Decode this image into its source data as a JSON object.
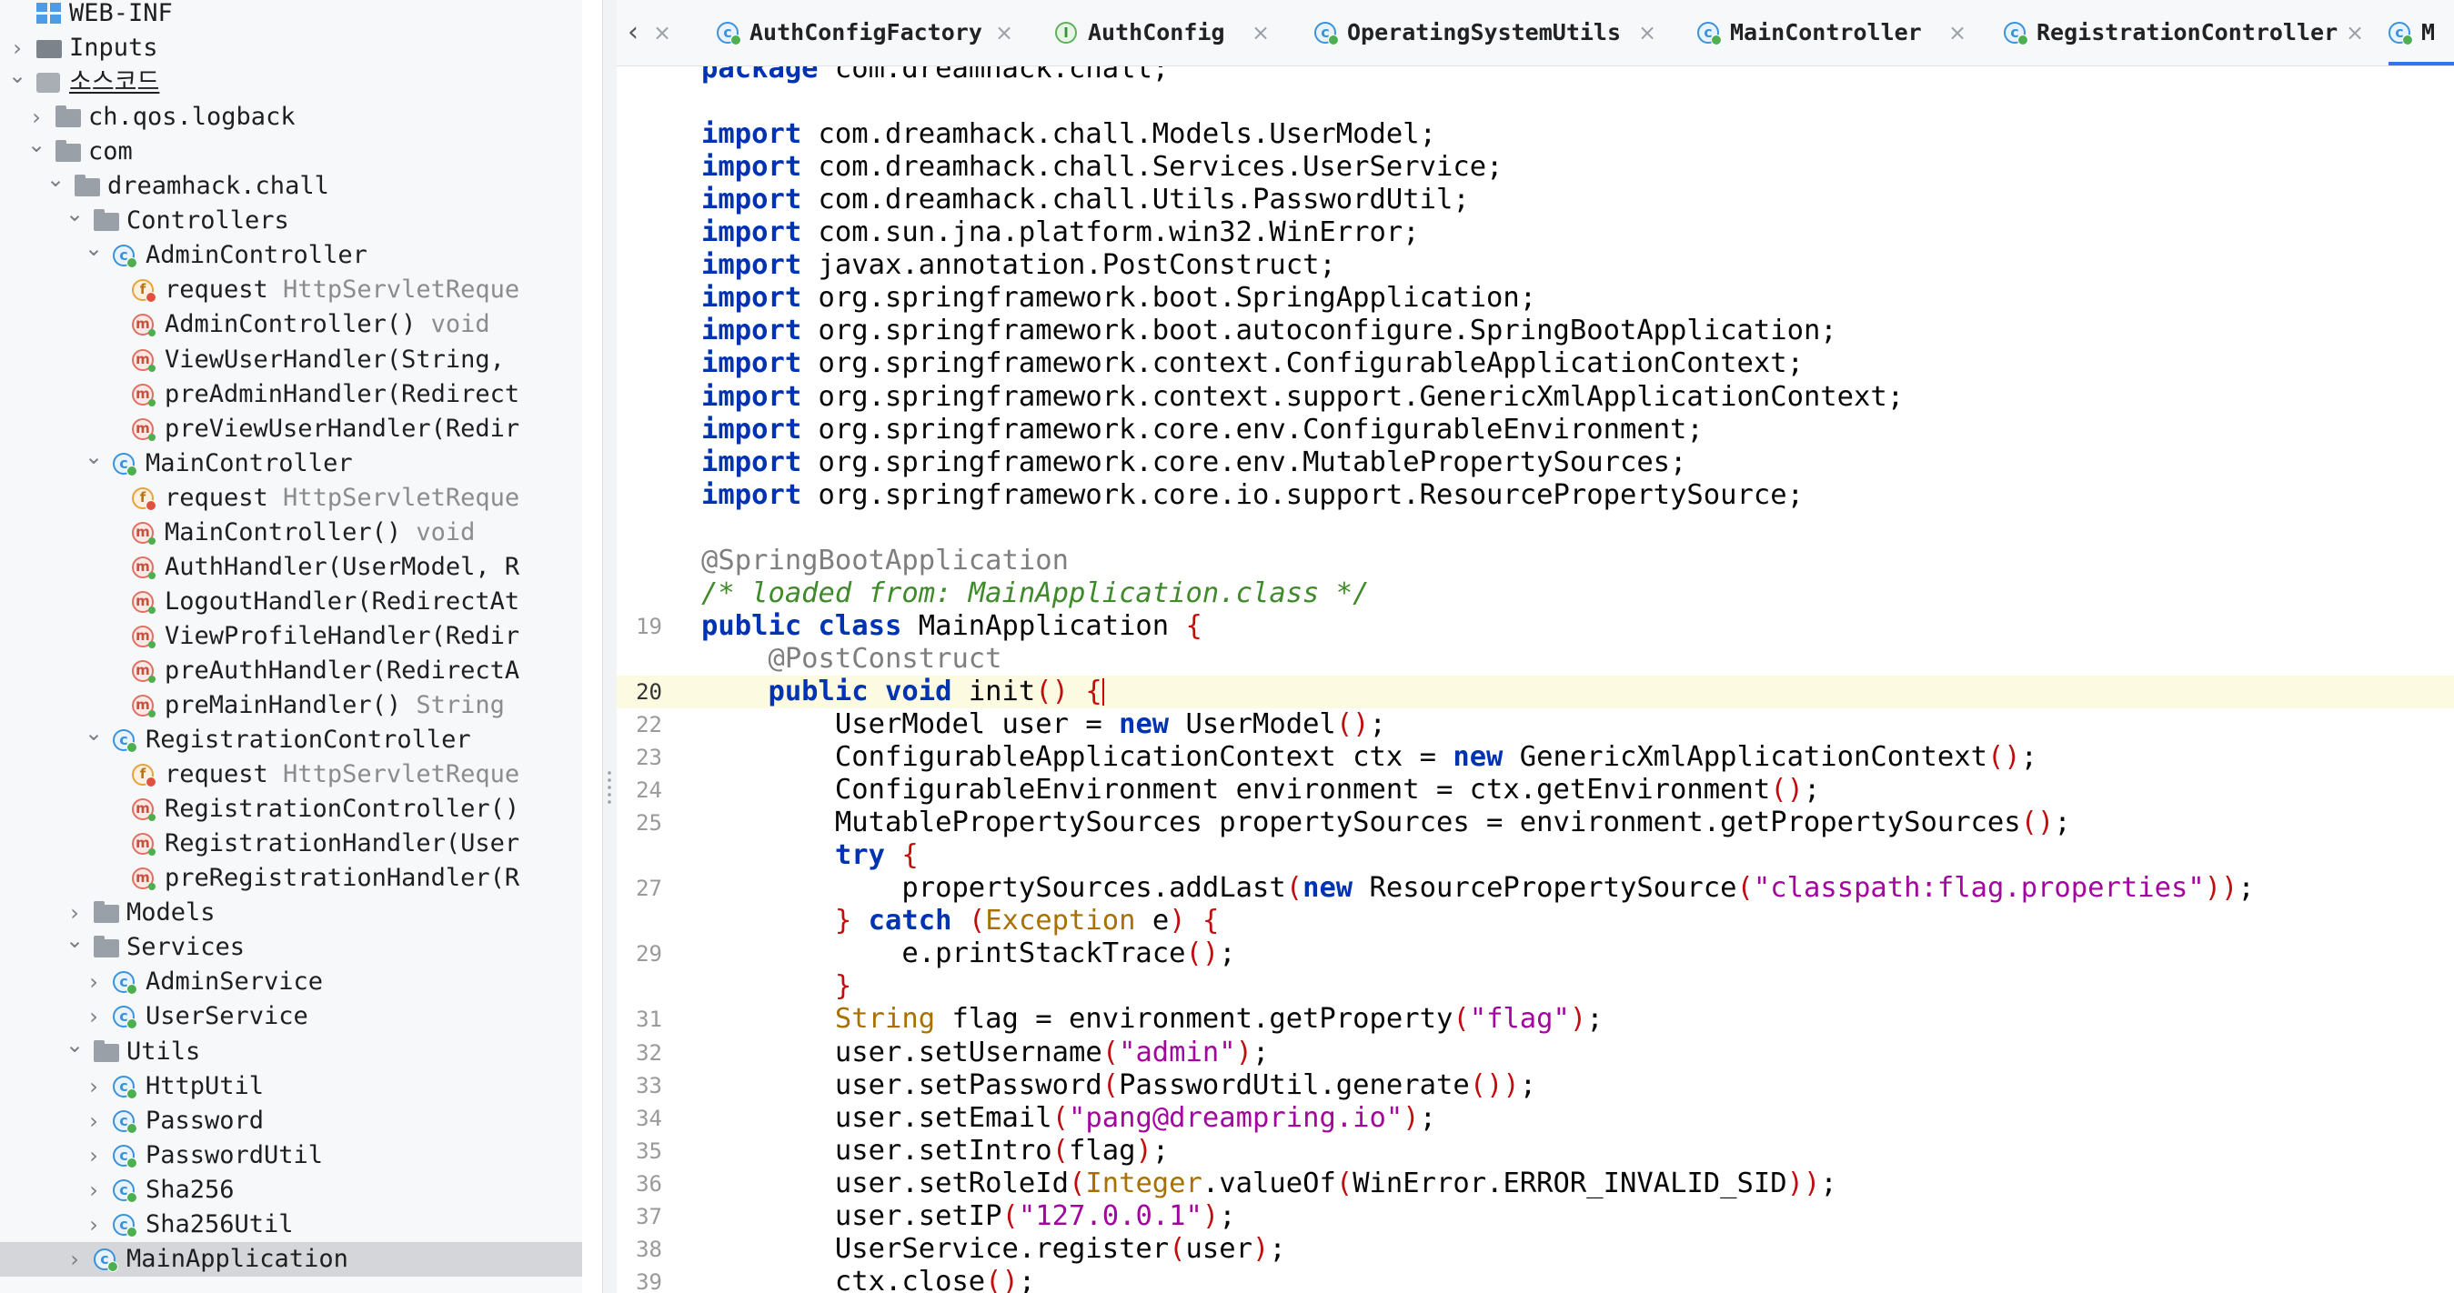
{
  "tree": [
    {
      "label": "WEB-INF",
      "icon": "web-inf-icon"
    },
    {
      "label": "Inputs",
      "icon": "inputs-folder-icon"
    },
    {
      "label": "소스코드",
      "icon": "source-root-icon"
    },
    {
      "label": "ch.qos.logback",
      "icon": "package-icon"
    },
    {
      "label": "com",
      "icon": "package-icon"
    },
    {
      "label": "dreamhack.chall",
      "icon": "package-icon"
    },
    {
      "label": "Controllers",
      "icon": "package-icon"
    },
    {
      "label": "AdminController",
      "icon": "class-icon"
    },
    {
      "label": "request",
      "type": "HttpServletReque",
      "icon": "field-icon"
    },
    {
      "label": "AdminController()",
      "type": "void",
      "icon": "method-icon"
    },
    {
      "label": "ViewUserHandler(String,",
      "icon": "method-icon"
    },
    {
      "label": "preAdminHandler(Redirect",
      "icon": "method-icon"
    },
    {
      "label": "preViewUserHandler(Redir",
      "icon": "method-icon"
    },
    {
      "label": "MainController",
      "icon": "class-icon"
    },
    {
      "label": "request",
      "type": "HttpServletReque",
      "icon": "field-icon"
    },
    {
      "label": "MainController()",
      "type": "void",
      "icon": "method-icon"
    },
    {
      "label": "AuthHandler(UserModel, R",
      "icon": "method-icon"
    },
    {
      "label": "LogoutHandler(RedirectAt",
      "icon": "method-icon"
    },
    {
      "label": "ViewProfileHandler(Redir",
      "icon": "method-icon"
    },
    {
      "label": "preAuthHandler(RedirectA",
      "icon": "method-icon"
    },
    {
      "label": "preMainHandler()",
      "type": "String",
      "icon": "method-icon"
    },
    {
      "label": "RegistrationController",
      "icon": "class-icon"
    },
    {
      "label": "request",
      "type": "HttpServletReque",
      "icon": "field-icon"
    },
    {
      "label": "RegistrationController()",
      "icon": "method-icon"
    },
    {
      "label": "RegistrationHandler(User",
      "icon": "method-icon"
    },
    {
      "label": "preRegistrationHandler(R",
      "icon": "method-icon"
    },
    {
      "label": "Models",
      "icon": "package-icon"
    },
    {
      "label": "Services",
      "icon": "package-icon"
    },
    {
      "label": "AdminService",
      "icon": "class-icon"
    },
    {
      "label": "UserService",
      "icon": "class-icon"
    },
    {
      "label": "Utils",
      "icon": "package-icon"
    },
    {
      "label": "HttpUtil",
      "icon": "class-icon"
    },
    {
      "label": "Password",
      "icon": "class-icon"
    },
    {
      "label": "PasswordUtil",
      "icon": "class-icon"
    },
    {
      "label": "Sha256",
      "icon": "class-icon"
    },
    {
      "label": "Sha256Util",
      "icon": "class-icon"
    },
    {
      "label": "MainApplication",
      "icon": "class-icon"
    }
  ],
  "tabs": [
    {
      "label": "AuthConfigFactory",
      "icon": "class-icon"
    },
    {
      "label": "AuthConfig",
      "icon": "interface-icon"
    },
    {
      "label": "OperatingSystemUtils",
      "icon": "class-icon"
    },
    {
      "label": "MainController",
      "icon": "class-icon"
    },
    {
      "label": "RegistrationController",
      "icon": "class-icon"
    },
    {
      "label": "M",
      "icon": "class-icon"
    }
  ],
  "tab_close_glyph": "×",
  "code": {
    "current_line": "20",
    "lines": [
      {
        "n": "",
        "t": [
          [
            "kw",
            "package"
          ],
          [
            "",
            "com.dreamhack.chall;"
          ]
        ]
      },
      {
        "n": "",
        "t": []
      },
      {
        "n": "",
        "t": [
          [
            "kw",
            "import"
          ],
          [
            "",
            " com.dreamhack.chall.Models.UserModel;"
          ]
        ]
      },
      {
        "n": "",
        "t": [
          [
            "kw",
            "import"
          ],
          [
            "",
            " com.dreamhack.chall.Services.UserService;"
          ]
        ]
      },
      {
        "n": "",
        "t": [
          [
            "kw",
            "import"
          ],
          [
            "",
            " com.dreamhack.chall.Utils.PasswordUtil;"
          ]
        ]
      },
      {
        "n": "",
        "t": [
          [
            "kw",
            "import"
          ],
          [
            "",
            " com.sun.jna.platform.win32.WinError;"
          ]
        ]
      },
      {
        "n": "",
        "t": [
          [
            "kw",
            "import"
          ],
          [
            "",
            " javax.annotation.PostConstruct;"
          ]
        ]
      },
      {
        "n": "",
        "t": [
          [
            "kw",
            "import"
          ],
          [
            "",
            " org.springframework.boot.SpringApplication;"
          ]
        ]
      },
      {
        "n": "",
        "t": [
          [
            "kw",
            "import"
          ],
          [
            "",
            " org.springframework.boot.autoconfigure.SpringBootApplication;"
          ]
        ]
      },
      {
        "n": "",
        "t": [
          [
            "kw",
            "import"
          ],
          [
            "",
            " org.springframework.context.ConfigurableApplicationContext;"
          ]
        ]
      },
      {
        "n": "",
        "t": [
          [
            "kw",
            "import"
          ],
          [
            "",
            " org.springframework.context.support.GenericXmlApplicationContext;"
          ]
        ]
      },
      {
        "n": "",
        "t": [
          [
            "kw",
            "import"
          ],
          [
            "",
            " org.springframework.core.env.ConfigurableEnvironment;"
          ]
        ]
      },
      {
        "n": "",
        "t": [
          [
            "kw",
            "import"
          ],
          [
            "",
            " org.springframework.core.env.MutablePropertySources;"
          ]
        ]
      },
      {
        "n": "",
        "t": [
          [
            "kw",
            "import"
          ],
          [
            "",
            " org.springframework.core.io.support.ResourcePropertySource;"
          ]
        ]
      },
      {
        "n": "",
        "t": []
      },
      {
        "n": "",
        "t": [
          [
            "ann",
            "@SpringBootApplication"
          ]
        ]
      },
      {
        "n": "",
        "t": [
          [
            "cm",
            "/* loaded from: MainApplication.class */"
          ]
        ]
      },
      {
        "n": "19",
        "t": [
          [
            "kw",
            "public class"
          ],
          [
            "",
            " MainApplication "
          ],
          [
            "par",
            "{"
          ]
        ]
      },
      {
        "n": "",
        "t": [
          [
            "ann",
            "    @PostConstruct"
          ]
        ]
      },
      {
        "n": "20",
        "t": [
          [
            "kw",
            "    public void"
          ],
          [
            "",
            " init"
          ],
          [
            "par",
            "()"
          ],
          [
            "",
            " "
          ],
          [
            "par",
            "{"
          ]
        ]
      },
      {
        "n": "22",
        "t": [
          [
            "",
            "        UserModel user = "
          ],
          [
            "kw",
            "new"
          ],
          [
            "",
            " UserModel"
          ],
          [
            "par",
            "()"
          ],
          [
            "",
            ";"
          ]
        ]
      },
      {
        "n": "23",
        "t": [
          [
            "",
            "        ConfigurableApplicationContext ctx = "
          ],
          [
            "kw",
            "new"
          ],
          [
            "",
            " GenericXmlApplicationContext"
          ],
          [
            "par",
            "()"
          ],
          [
            "",
            ";"
          ]
        ]
      },
      {
        "n": "24",
        "t": [
          [
            "",
            "        ConfigurableEnvironment environment = ctx.getEnvironment"
          ],
          [
            "par",
            "()"
          ],
          [
            "",
            ";"
          ]
        ]
      },
      {
        "n": "25",
        "t": [
          [
            "",
            "        MutablePropertySources propertySources = environment.getPropertySources"
          ],
          [
            "par",
            "()"
          ],
          [
            "",
            ";"
          ]
        ]
      },
      {
        "n": "",
        "t": [
          [
            "kw",
            "        try"
          ],
          [
            "",
            " "
          ],
          [
            "par",
            "{"
          ]
        ]
      },
      {
        "n": "27",
        "t": [
          [
            "",
            "            propertySources.addLast"
          ],
          [
            "par",
            "("
          ],
          [
            "kw",
            "new"
          ],
          [
            "",
            " ResourcePropertySource"
          ],
          [
            "par",
            "("
          ],
          [
            "str",
            "\"classpath:flag.properties\""
          ],
          [
            "par",
            "))"
          ],
          [
            "",
            ";"
          ]
        ]
      },
      {
        "n": "",
        "t": [
          [
            "par",
            "        }"
          ],
          [
            "",
            " "
          ],
          [
            "kw",
            "catch"
          ],
          [
            "",
            " "
          ],
          [
            "par",
            "("
          ],
          [
            "cls",
            "Exception"
          ],
          [
            "",
            " e"
          ],
          [
            "par",
            ")"
          ],
          [
            "",
            " "
          ],
          [
            "par",
            "{"
          ]
        ]
      },
      {
        "n": "29",
        "t": [
          [
            "",
            "            e.printStackTrace"
          ],
          [
            "par",
            "()"
          ],
          [
            "",
            ";"
          ]
        ]
      },
      {
        "n": "",
        "t": [
          [
            "par",
            "        }"
          ]
        ]
      },
      {
        "n": "31",
        "t": [
          [
            "cls",
            "        String"
          ],
          [
            "",
            " flag = environment.getProperty"
          ],
          [
            "par",
            "("
          ],
          [
            "str",
            "\"flag\""
          ],
          [
            "par",
            ")"
          ],
          [
            "",
            ";"
          ]
        ]
      },
      {
        "n": "32",
        "t": [
          [
            "",
            "        user.setUsername"
          ],
          [
            "par",
            "("
          ],
          [
            "str",
            "\"admin\""
          ],
          [
            "par",
            ")"
          ],
          [
            "",
            ";"
          ]
        ]
      },
      {
        "n": "33",
        "t": [
          [
            "",
            "        user.setPassword"
          ],
          [
            "par",
            "("
          ],
          [
            "",
            "PasswordUtil.generate"
          ],
          [
            "par",
            "())"
          ],
          [
            "",
            ";"
          ]
        ]
      },
      {
        "n": "34",
        "t": [
          [
            "",
            "        user.setEmail"
          ],
          [
            "par",
            "("
          ],
          [
            "str",
            "\"pang@dreampring.io\""
          ],
          [
            "par",
            ")"
          ],
          [
            "",
            ";"
          ]
        ]
      },
      {
        "n": "35",
        "t": [
          [
            "",
            "        user.setIntro"
          ],
          [
            "par",
            "("
          ],
          [
            "",
            "flag"
          ],
          [
            "par",
            ")"
          ],
          [
            "",
            ";"
          ]
        ]
      },
      {
        "n": "36",
        "t": [
          [
            "",
            "        user.setRoleId"
          ],
          [
            "par",
            "("
          ],
          [
            "cls",
            "Integer"
          ],
          [
            "",
            ".valueOf"
          ],
          [
            "par",
            "("
          ],
          [
            "",
            "WinError.ERROR_INVALID_SID"
          ],
          [
            "par",
            "))"
          ],
          [
            "",
            ";"
          ]
        ]
      },
      {
        "n": "37",
        "t": [
          [
            "",
            "        user.setIP"
          ],
          [
            "par",
            "("
          ],
          [
            "str",
            "\"127.0.0.1\""
          ],
          [
            "par",
            ")"
          ],
          [
            "",
            ";"
          ]
        ]
      },
      {
        "n": "38",
        "t": [
          [
            "",
            "        UserService.register"
          ],
          [
            "par",
            "("
          ],
          [
            "",
            "user"
          ],
          [
            "par",
            ")"
          ],
          [
            "",
            ";"
          ]
        ]
      },
      {
        "n": "39",
        "t": [
          [
            "",
            "        ctx.close"
          ],
          [
            "par",
            "()"
          ],
          [
            "",
            ";"
          ]
        ]
      }
    ]
  }
}
